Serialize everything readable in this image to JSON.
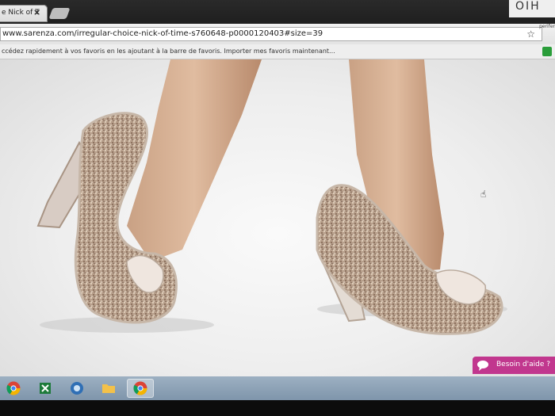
{
  "browser": {
    "tab": {
      "title": "e Nick of T",
      "close_glyph": "×"
    },
    "sticky_note_text": "OIH",
    "address": {
      "url": "www.sarenza.com/irregular-choice-nick-of-time-s760648-p0000120403#size=39",
      "profile_label": "perifer"
    },
    "bookmarks_bar": {
      "message": "ccédez rapidement à vos favoris en les ajoutant à la barre de favoris.",
      "import_link": "Importer mes favoris maintenant..."
    }
  },
  "page": {
    "help_button_label": "Besoin d'aide ?",
    "help_button_color": "#c1378e"
  },
  "taskbar": {
    "items": [
      {
        "icon": "chrome-icon"
      },
      {
        "icon": "excel-icon"
      },
      {
        "icon": "app-globe-icon"
      },
      {
        "icon": "folder-icon"
      },
      {
        "icon": "chrome-icon",
        "active": true
      },
      {
        "icon": "start-pin-icon"
      }
    ]
  }
}
